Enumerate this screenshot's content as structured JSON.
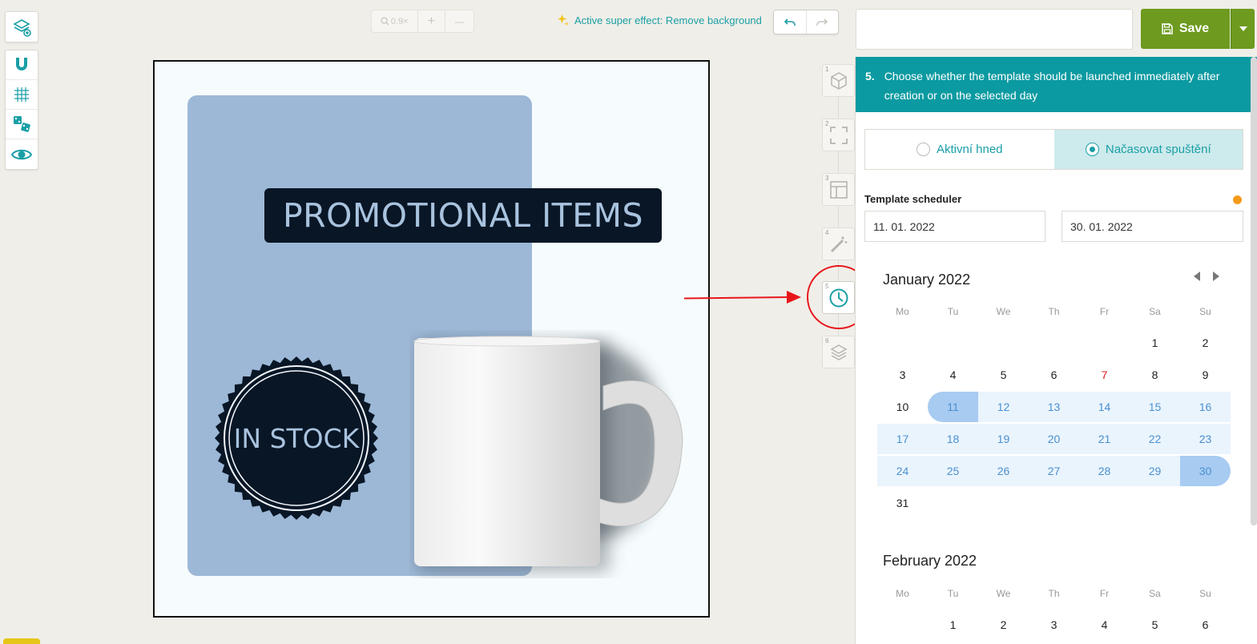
{
  "left_toolbar": {
    "top_icon": "layers-add-icon",
    "icons": [
      "magnet-icon",
      "grid-icon",
      "dice-icon",
      "eye-icon"
    ]
  },
  "zoom": {
    "level": "0.9×",
    "plus": "+",
    "minus": "—"
  },
  "effect": {
    "icon": "sparkle-icon",
    "text": "Active super effect: Remove background"
  },
  "template_name": {
    "value": "",
    "placeholder": ""
  },
  "save": {
    "label": "Save"
  },
  "canvas": {
    "headline": "PROMOTIONAL ITEMS",
    "badge": "IN STOCK"
  },
  "steps": [
    {
      "number": "1",
      "icon": "cube-icon"
    },
    {
      "number": "2",
      "icon": "resize-icon"
    },
    {
      "number": "3",
      "icon": "layout-icon"
    },
    {
      "number": "4",
      "icon": "magic-wand-icon"
    },
    {
      "number": "5",
      "icon": "clock-icon"
    },
    {
      "number": "6",
      "icon": "layers-icon"
    }
  ],
  "panel": {
    "step_number": "5.",
    "step_text": "Choose whether the template should be launched immediately after creation or on the selected day",
    "option_immediate": "Aktivní hned",
    "option_scheduled": "Načasovat spuštění",
    "scheduler_label": "Template scheduler",
    "date_from": "11. 01. 2022",
    "date_to": "30. 01. 2022"
  },
  "calendar": {
    "weekdays": [
      "Mo",
      "Tu",
      "We",
      "Th",
      "Fr",
      "Sa",
      "Su"
    ],
    "months": [
      {
        "title": "January 2022",
        "weeks": [
          [
            "",
            "",
            "",
            "",
            "",
            "1",
            "2"
          ],
          [
            "3",
            "4",
            "5",
            "6",
            "7",
            "8",
            "9"
          ],
          [
            "10",
            "11",
            "12",
            "13",
            "14",
            "15",
            "16"
          ],
          [
            "17",
            "18",
            "19",
            "20",
            "21",
            "22",
            "23"
          ],
          [
            "24",
            "25",
            "26",
            "27",
            "28",
            "29",
            "30"
          ],
          [
            "31",
            "",
            "",
            "",
            "",
            "",
            ""
          ]
        ]
      },
      {
        "title": "February 2022",
        "weeks": [
          [
            "",
            "1",
            "2",
            "3",
            "4",
            "5",
            "6"
          ]
        ]
      }
    ],
    "range_start": "11",
    "range_end": "30",
    "holiday": "7"
  },
  "colors": {
    "teal": "#0b9aa1",
    "save_green": "#6d9a1f",
    "range_fill": "#eaf4fd",
    "range_endpoint": "#a8cbf2",
    "annotation_red": "#e8161b"
  }
}
